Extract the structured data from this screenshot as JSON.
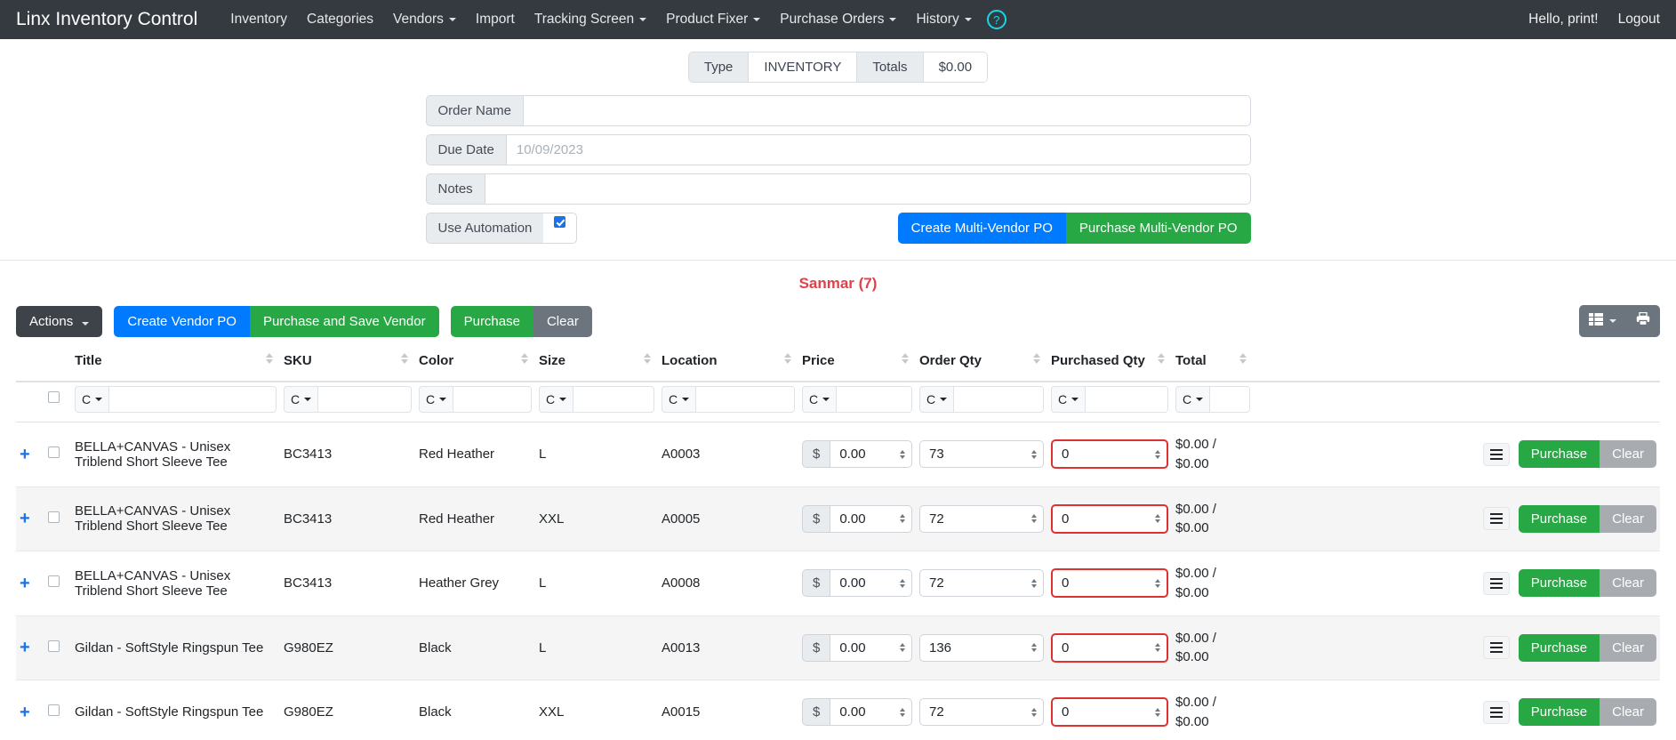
{
  "navbar": {
    "brand": "Linx Inventory Control",
    "items": [
      {
        "label": "Inventory",
        "dropdown": false
      },
      {
        "label": "Categories",
        "dropdown": false
      },
      {
        "label": "Vendors",
        "dropdown": true
      },
      {
        "label": "Import",
        "dropdown": false
      },
      {
        "label": "Tracking Screen",
        "dropdown": true
      },
      {
        "label": "Product Fixer",
        "dropdown": true
      },
      {
        "label": "Purchase Orders",
        "dropdown": true
      },
      {
        "label": "History",
        "dropdown": true
      }
    ],
    "help_icon": "question-mark-icon",
    "help_label": "?",
    "greeting": "Hello, print!",
    "logout": "Logout"
  },
  "type_bar": {
    "type_label": "Type",
    "inventory_label": "INVENTORY",
    "totals_label": "Totals",
    "totals_value": "$0.00"
  },
  "order_form": {
    "order_name_label": "Order Name",
    "order_name_value": "",
    "order_name_placeholder": "",
    "due_date_label": "Due Date",
    "due_date_value": "10/09/2023",
    "notes_label": "Notes",
    "notes_value": "",
    "notes_placeholder": "",
    "use_automation_label": "Use Automation",
    "use_automation_checked": true,
    "create_multi_vendor_po": "Create Multi-Vendor PO",
    "purchase_multi_vendor_po": "Purchase Multi-Vendor PO"
  },
  "vendor": {
    "title": "Sanmar (7)"
  },
  "action_bar": {
    "actions_label": "Actions",
    "create_vendor_po": "Create Vendor PO",
    "purchase_and_save_vendor": "Purchase and Save Vendor",
    "purchase": "Purchase",
    "clear": "Clear",
    "columns_icon": "columns-grid-icon",
    "print_icon": "printer-icon"
  },
  "table": {
    "columns": [
      {
        "label": "Title"
      },
      {
        "label": "SKU"
      },
      {
        "label": "Color"
      },
      {
        "label": "Size"
      },
      {
        "label": "Location"
      },
      {
        "label": "Price"
      },
      {
        "label": "Order Qty"
      },
      {
        "label": "Purchased Qty"
      },
      {
        "label": "Total"
      }
    ],
    "filter_select_label": "C",
    "filter_values": [
      "",
      "",
      "",
      "",
      "",
      "",
      "",
      "",
      ""
    ],
    "rows": [
      {
        "title": "BELLA+CANVAS - Unisex Triblend Short Sleeve Tee",
        "sku": "BC3413",
        "color": "Red Heather",
        "size": "L",
        "location": "A0003",
        "price_symbol": "$",
        "price": "0.00",
        "order_qty": "73",
        "purchased_qty": "0",
        "total": "$0.00 / $0.00",
        "purchase_label": "Purchase",
        "clear_label": "Clear"
      },
      {
        "title": "BELLA+CANVAS - Unisex Triblend Short Sleeve Tee",
        "sku": "BC3413",
        "color": "Red Heather",
        "size": "XXL",
        "location": "A0005",
        "price_symbol": "$",
        "price": "0.00",
        "order_qty": "72",
        "purchased_qty": "0",
        "total": "$0.00 / $0.00",
        "purchase_label": "Purchase",
        "clear_label": "Clear"
      },
      {
        "title": "BELLA+CANVAS - Unisex Triblend Short Sleeve Tee",
        "sku": "BC3413",
        "color": "Heather Grey",
        "size": "L",
        "location": "A0008",
        "price_symbol": "$",
        "price": "0.00",
        "order_qty": "72",
        "purchased_qty": "0",
        "total": "$0.00 / $0.00",
        "purchase_label": "Purchase",
        "clear_label": "Clear"
      },
      {
        "title": "Gildan - SoftStyle Ringspun Tee",
        "sku": "G980EZ",
        "color": "Black",
        "size": "L",
        "location": "A0013",
        "price_symbol": "$",
        "price": "0.00",
        "order_qty": "136",
        "purchased_qty": "0",
        "total": "$0.00 / $0.00",
        "purchase_label": "Purchase",
        "clear_label": "Clear"
      },
      {
        "title": "Gildan - SoftStyle Ringspun Tee",
        "sku": "G980EZ",
        "color": "Black",
        "size": "XXL",
        "location": "A0015",
        "price_symbol": "$",
        "price": "0.00",
        "order_qty": "72",
        "purchased_qty": "0",
        "total": "$0.00 / $0.00",
        "purchase_label": "Purchase",
        "clear_label": "Clear"
      }
    ]
  },
  "colors": {
    "navbar": "#343a40",
    "primary": "#007bff",
    "success": "#28a745",
    "danger": "#e03131",
    "vendor_red": "#e3404a",
    "help_cyan": "#17d6e8"
  }
}
